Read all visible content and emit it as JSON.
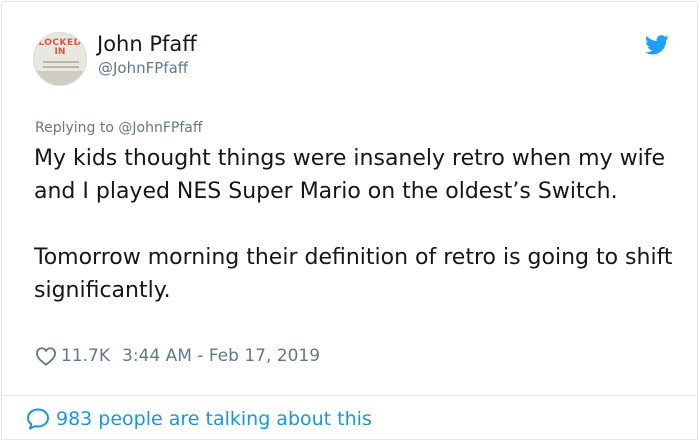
{
  "author": {
    "display_name": "John Pfaff",
    "handle": "@JohnFPfaff",
    "avatar_text_line1": "LOCKED",
    "avatar_text_line2": "IN"
  },
  "reply_context": {
    "prefix": "Replying to ",
    "handle": "@JohnFPfaff"
  },
  "tweet": {
    "text": "My kids thought things were insanely retro when my wife and I played NES Super Mario on the oldest’s Switch.\n\nTomorrow morning their definition of retro is going to shift significantly.",
    "likes": "11.7K",
    "timestamp": "3:44 AM - Feb 17, 2019"
  },
  "conversation": {
    "label": "983 people are talking about this"
  },
  "icons": {
    "brand": "twitter-bird-icon",
    "like": "heart-icon",
    "reply": "speech-bubble-icon"
  },
  "colors": {
    "brand_blue": "#1da1f2",
    "link_blue": "#1b95e0",
    "secondary_text": "#657786",
    "primary_text": "#14171a",
    "border": "#e1e8ed"
  }
}
